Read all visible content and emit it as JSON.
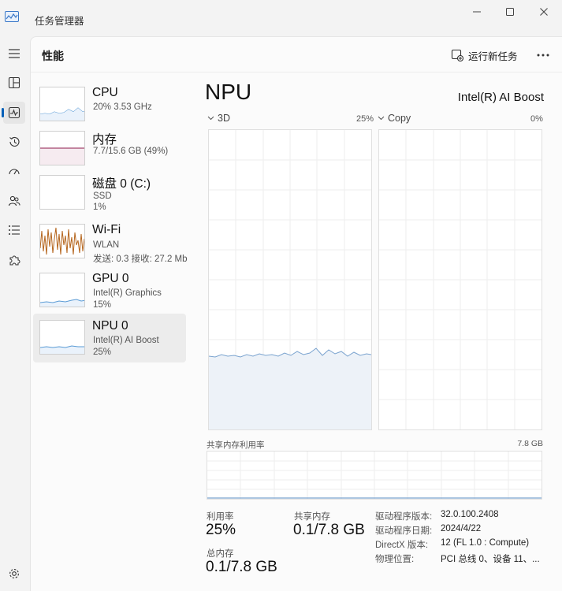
{
  "window": {
    "title": "任务管理器"
  },
  "page": {
    "title": "性能",
    "run_task_label": "运行新任务"
  },
  "colors": {
    "accent": "#005fb8",
    "cpu": "#5a9bd5",
    "memory": "#a3456e",
    "wifi": "#b5651d",
    "npu_fill": "#edf2f8"
  },
  "devices": [
    {
      "name": "CPU",
      "line1": "20% 3.53 GHz",
      "line2": "",
      "usage_percent": 20
    },
    {
      "name": "内存",
      "line1": "7.7/15.6 GB (49%)",
      "line2": "",
      "usage_percent": 49
    },
    {
      "name": "磁盘 0 (C:)",
      "line1": "SSD",
      "line2": "1%",
      "usage_percent": 1
    },
    {
      "name": "Wi-Fi",
      "line1": "WLAN",
      "line2": "发送: 0.3 接收: 27.2 Mb",
      "usage_percent": 60
    },
    {
      "name": "GPU 0",
      "line1": "Intel(R) Graphics",
      "line2": "15%",
      "usage_percent": 15
    },
    {
      "name": "NPU 0",
      "line1": "Intel(R) AI Boost",
      "line2": "25%",
      "usage_percent": 25
    }
  ],
  "detail": {
    "title": "NPU",
    "device": "Intel(R) AI Boost",
    "graph1_label": "3D",
    "graph1_pct": "25%",
    "graph2_label": "Copy",
    "graph2_pct": "0%",
    "shared_mem_label": "共享内存利用率",
    "shared_mem_max": "7.8 GB",
    "utilization_label": "利用率",
    "utilization_value": "25%",
    "shared_label": "共享内存",
    "shared_value": "0.1/7.8 GB",
    "total_label": "总内存",
    "total_value": "0.1/7.8 GB",
    "info": [
      {
        "key": "驱动程序版本:",
        "value": "32.0.100.2408"
      },
      {
        "key": "驱动程序日期:",
        "value": "2024/4/22"
      },
      {
        "key": "DirectX 版本:",
        "value": "12 (FL 1.0 : Compute)"
      },
      {
        "key": "物理位置:",
        "value": "PCI 总线 0、设备 11、..."
      }
    ]
  }
}
